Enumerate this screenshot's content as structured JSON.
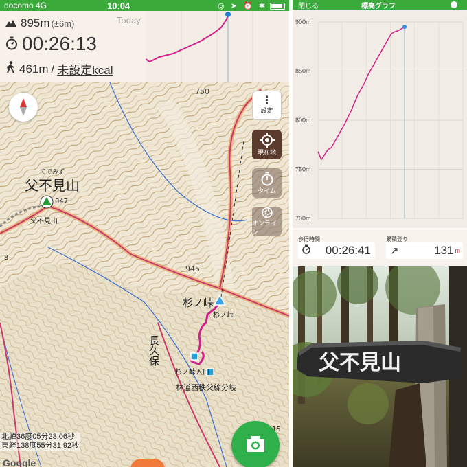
{
  "status_bar": {
    "carrier": "docomo  4G",
    "time": "10:04"
  },
  "stats": {
    "altitude": "895m",
    "altitude_accuracy": "(±6m)",
    "elapsed_time": "00:26:13",
    "distance": "461m",
    "separator": "/",
    "calories": "未設定kcal"
  },
  "mini_graph": {
    "label": "Today"
  },
  "map_buttons": {
    "settings": "設定",
    "location": "現在地",
    "timer": "タイム",
    "online": "オンライン"
  },
  "map_labels": {
    "peak_furigana": "てでみず",
    "peak_name": "父不見山",
    "peak_small": "父不見山",
    "peak_elev": "047",
    "contour_750": "750",
    "contour_945": "945",
    "pass_name": "杉ノ峠",
    "pass_small": "杉ノ峠",
    "pass_entrance": "杉ノ峠入口",
    "road_junction": "林道西秩父線分岐",
    "place_vertical": "長久保",
    "edge_8": "8",
    "edge_15": "15"
  },
  "coordinates": {
    "lat": "北緯36度05分23.06秒",
    "lon": "東経138度55分31.92秒"
  },
  "map_attribution": "Google",
  "elevation_panel": {
    "back": "閉じる",
    "title": "標高グラフ",
    "y_ticks": [
      "900m",
      "850m",
      "800m",
      "750m",
      "700m"
    ],
    "time_label": "歩行時間",
    "time_value": "00:26:41",
    "climb_label": "累積登り",
    "climb_value": "131",
    "climb_unit": "m"
  },
  "chart_data": {
    "type": "line",
    "title": "標高グラフ",
    "ylim": [
      700,
      900
    ],
    "y_ticks": [
      900,
      850,
      800,
      750,
      700
    ],
    "y_unit": "m",
    "x": [
      0,
      1,
      2,
      3,
      4,
      5,
      6,
      7,
      8,
      9,
      10,
      11,
      12,
      13,
      14,
      15,
      16,
      17,
      18,
      19,
      20,
      21,
      22,
      23,
      24,
      25,
      26
    ],
    "series": [
      {
        "values": [
          768,
          760,
          765,
          770,
          772,
          778,
          784,
          790,
          796,
          803,
          810,
          818,
          826,
          832,
          838,
          846,
          852,
          858,
          864,
          870,
          876,
          882,
          888,
          890,
          891,
          893,
          895
        ]
      }
    ]
  },
  "sign_text": "父不見山"
}
